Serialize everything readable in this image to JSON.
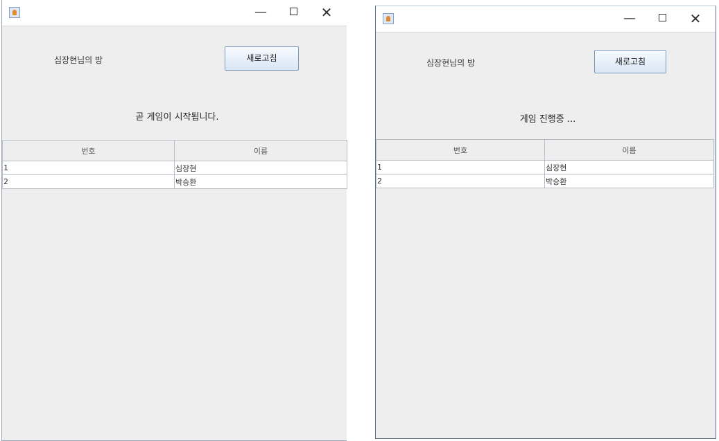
{
  "windows": [
    {
      "id": "left",
      "controls": {
        "minimize": "—",
        "close": "✕"
      },
      "room_title": "심장현님의 방",
      "refresh_label": "새로고침",
      "status": "곧 게임이 시작됩니다.",
      "table": {
        "headers": [
          "번호",
          "이름"
        ],
        "rows": [
          [
            "1",
            "심장현"
          ],
          [
            "2",
            "박승환"
          ]
        ]
      }
    },
    {
      "id": "right",
      "controls": {
        "minimize": "—",
        "close": "✕"
      },
      "room_title": "심장현님의 방",
      "refresh_label": "새로고침",
      "status": "게임 진행중 ...",
      "table": {
        "headers": [
          "번호",
          "이름"
        ],
        "rows": [
          [
            "1",
            "심장현"
          ],
          [
            "2",
            "박승환"
          ]
        ]
      }
    }
  ],
  "colors": {
    "window_bg": "#eeeeee",
    "titlebar_bg": "#ffffff",
    "button_border": "#7a99bb",
    "grid_line": "#b9bec6"
  },
  "icons": [
    "java-app-icon",
    "minimize-icon",
    "maximize-icon",
    "close-icon"
  ]
}
